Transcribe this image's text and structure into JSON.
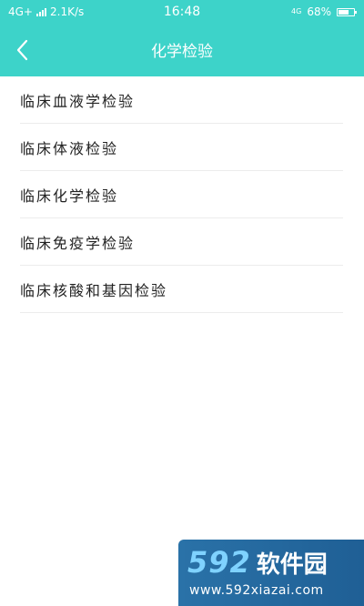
{
  "status_bar": {
    "network": "4G+",
    "speed": "2.1K/s",
    "time": "16:48",
    "right_network": "4G",
    "battery": "68%",
    "battery_level": 0.68
  },
  "nav": {
    "title": "化学检验",
    "back_icon": "chevron-left-icon"
  },
  "list": {
    "items": [
      {
        "label": "临床血液学检验"
      },
      {
        "label": "临床体液检验"
      },
      {
        "label": "临床化学检验"
      },
      {
        "label": "临床免疫学检验"
      },
      {
        "label": "临床核酸和基因检验"
      }
    ]
  },
  "watermark": {
    "digits": "592",
    "name": "软件园",
    "url": "www.592xiazai.com"
  },
  "colors": {
    "header_bg": "#3dd3c9",
    "text": "#222222",
    "divider": "#ececec"
  }
}
